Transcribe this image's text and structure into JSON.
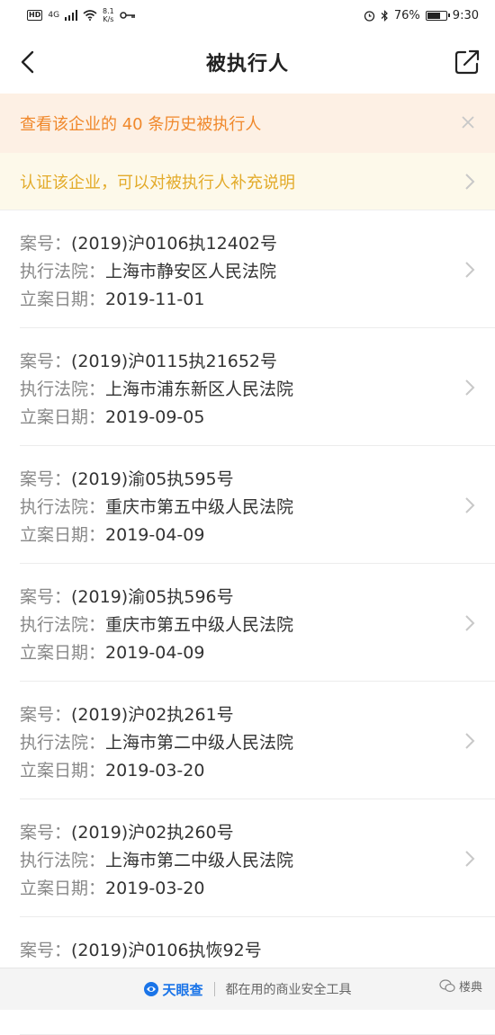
{
  "statusbar": {
    "network": "4G",
    "speed_value": "8.1",
    "speed_unit": "K/s",
    "battery_percent": "76%",
    "battery_level": 0.76,
    "time": "9:30"
  },
  "nav": {
    "title": "被执行人"
  },
  "banner_history": {
    "text": "查看该企业的 40 条历史被执行人"
  },
  "banner_certify": {
    "text": "认证该企业，可以对被执行人补充说明"
  },
  "labels": {
    "case_no": "案号：",
    "court": "执行法院：",
    "date": "立案日期："
  },
  "records": [
    {
      "case_no": "(2019)沪0106执12402号",
      "court": "上海市静安区人民法院",
      "date": "2019-11-01"
    },
    {
      "case_no": "(2019)沪0115执21652号",
      "court": "上海市浦东新区人民法院",
      "date": "2019-09-05"
    },
    {
      "case_no": "(2019)渝05执595号",
      "court": "重庆市第五中级人民法院",
      "date": "2019-04-09"
    },
    {
      "case_no": "(2019)渝05执596号",
      "court": "重庆市第五中级人民法院",
      "date": "2019-04-09"
    },
    {
      "case_no": "(2019)沪02执261号",
      "court": "上海市第二中级人民法院",
      "date": "2019-03-20"
    },
    {
      "case_no": "(2019)沪02执260号",
      "court": "上海市第二中级人民法院",
      "date": "2019-03-20"
    },
    {
      "case_no": "(2019)沪0106执恢92号",
      "court": "",
      "date": ""
    }
  ],
  "footer": {
    "brand": "天眼查",
    "slogan": "都在用的商业安全工具",
    "watermark": "楼典"
  },
  "colors": {
    "accent_orange": "#f0882b",
    "accent_yellow": "#e3ab2a",
    "brand_blue": "#1a74e8"
  }
}
